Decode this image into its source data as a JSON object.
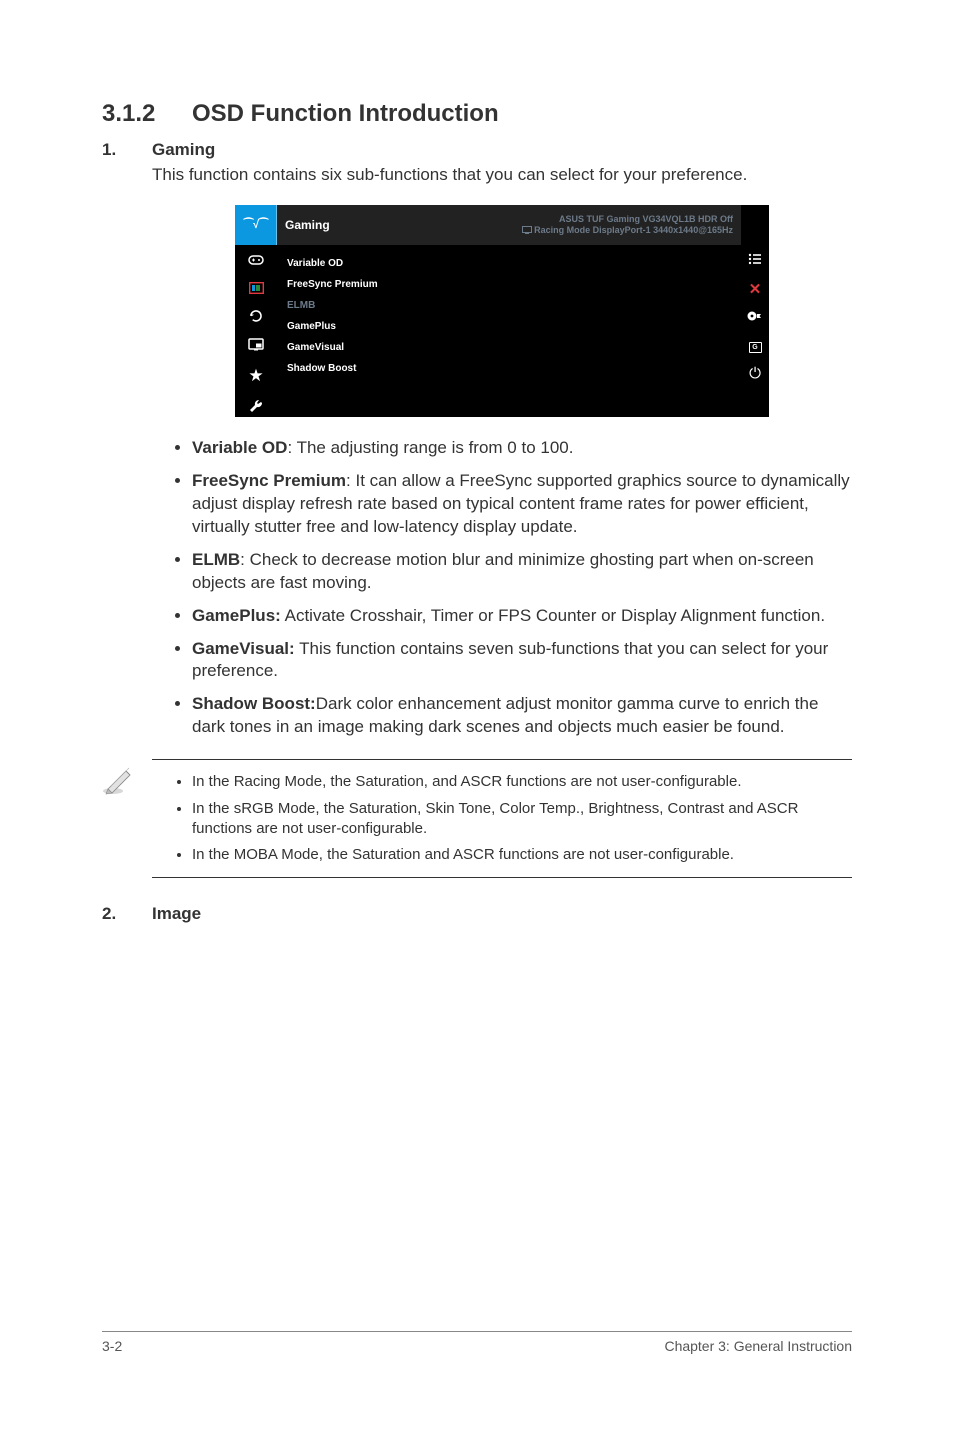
{
  "heading": {
    "number": "3.1.2",
    "title": "OSD Function Introduction"
  },
  "section1": {
    "number": "1.",
    "title": "Gaming",
    "intro": "This function contains six sub-functions that you can select for your preference."
  },
  "osd": {
    "menu_title": "Gaming",
    "header_line1": "ASUS TUF Gaming VG34VQL1B  HDR Off",
    "header_line2": "Racing Mode DisplayPort-1 3440x1440@165Hz",
    "left_icons": [
      "pulse-icon",
      "controller-icon",
      "image-icon",
      "rotate-icon",
      "pip-icon",
      "star-icon",
      "wrench-icon"
    ],
    "items": [
      {
        "label": "Variable OD",
        "dim": false
      },
      {
        "label": "FreeSync Premium",
        "dim": false
      },
      {
        "label": "ELMB",
        "dim": true
      },
      {
        "label": "GamePlus",
        "dim": false
      },
      {
        "label": "GameVisual",
        "dim": false
      },
      {
        "label": "Shadow Boost",
        "dim": false
      }
    ],
    "right_icons": [
      "menu-list-icon",
      "close-x-icon",
      "joystick-dot-icon",
      "g-box-icon",
      "power-icon"
    ]
  },
  "bullets": [
    {
      "bold": "Variable OD",
      "sep": ": ",
      "text": "The adjusting range is from 0 to 100."
    },
    {
      "bold": "FreeSync Premium",
      "sep": ": ",
      "text": "It can allow a FreeSync supported graphics source to dynamically adjust display refresh rate based on typical content frame rates for power efficient, virtually stutter free and low-latency display update."
    },
    {
      "bold": "ELMB",
      "sep": ": ",
      "text": "Check to decrease motion blur and minimize ghosting part when on-screen objects are fast moving."
    },
    {
      "bold": "GamePlus:",
      "sep": " ",
      "text": "Activate Crosshair, Timer or FPS Counter or Display Alignment function."
    },
    {
      "bold": "GameVisual:",
      "sep": " ",
      "text": "This function contains seven sub-functions that you can select for your preference."
    },
    {
      "bold": "Shadow Boost:",
      "sep": "",
      "text": "Dark color enhancement adjust monitor gamma curve to enrich the dark tones in an image making dark scenes and objects much easier be found."
    }
  ],
  "notes": [
    "In the Racing Mode, the Saturation, and ASCR functions are not user-configurable.",
    "In the sRGB Mode, the Saturation, Skin Tone, Color Temp., Brightness, Contrast and ASCR functions are not user-configurable.",
    "In the MOBA Mode, the Saturation and ASCR functions are not user-configurable."
  ],
  "section2": {
    "number": "2.",
    "title": "Image"
  },
  "footer": {
    "left": "3-2",
    "right": "Chapter 3: General Instruction"
  }
}
